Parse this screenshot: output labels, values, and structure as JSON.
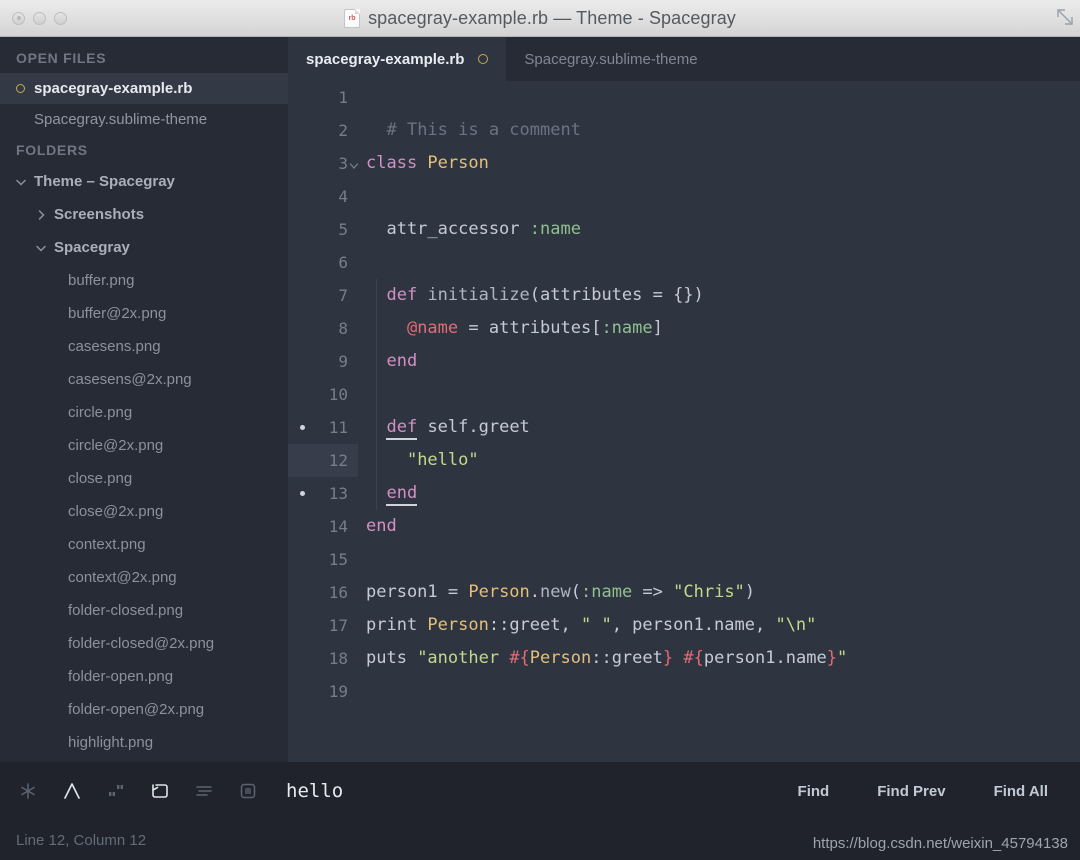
{
  "window": {
    "title": "spacegray-example.rb — Theme - Spacegray",
    "file_icon_label": "rb",
    "traffic_lights": [
      "close",
      "minimize",
      "zoom"
    ]
  },
  "sidebar": {
    "open_files_header": "OPEN FILES",
    "open_files": [
      {
        "label": "spacegray-example.rb",
        "active": true,
        "modified": true
      },
      {
        "label": "Spacegray.sublime-theme",
        "active": false,
        "modified": false
      }
    ],
    "folders_header": "FOLDERS",
    "tree": [
      {
        "label": "Theme – Spacegray",
        "type": "folder",
        "depth": 0,
        "expanded": true
      },
      {
        "label": "Screenshots",
        "type": "folder",
        "depth": 1,
        "expanded": false
      },
      {
        "label": "Spacegray",
        "type": "folder",
        "depth": 1,
        "expanded": true
      },
      {
        "label": "buffer.png",
        "type": "file",
        "depth": 2
      },
      {
        "label": "buffer@2x.png",
        "type": "file",
        "depth": 2
      },
      {
        "label": "casesens.png",
        "type": "file",
        "depth": 2
      },
      {
        "label": "casesens@2x.png",
        "type": "file",
        "depth": 2
      },
      {
        "label": "circle.png",
        "type": "file",
        "depth": 2
      },
      {
        "label": "circle@2x.png",
        "type": "file",
        "depth": 2
      },
      {
        "label": "close.png",
        "type": "file",
        "depth": 2
      },
      {
        "label": "close@2x.png",
        "type": "file",
        "depth": 2
      },
      {
        "label": "context.png",
        "type": "file",
        "depth": 2
      },
      {
        "label": "context@2x.png",
        "type": "file",
        "depth": 2
      },
      {
        "label": "folder-closed.png",
        "type": "file",
        "depth": 2
      },
      {
        "label": "folder-closed@2x.png",
        "type": "file",
        "depth": 2
      },
      {
        "label": "folder-open.png",
        "type": "file",
        "depth": 2
      },
      {
        "label": "folder-open@2x.png",
        "type": "file",
        "depth": 2
      },
      {
        "label": "highlight.png",
        "type": "file",
        "depth": 2
      }
    ]
  },
  "tabs": [
    {
      "label": "spacegray-example.rb",
      "active": true,
      "modified": true
    },
    {
      "label": "Spacegray.sublime-theme",
      "active": false,
      "modified": false
    }
  ],
  "editor": {
    "language": "ruby",
    "active_line": 12,
    "bookmarked_lines": [
      11,
      13
    ],
    "fold_lines": [
      3
    ],
    "lines": [
      {
        "n": 1,
        "tokens": []
      },
      {
        "n": 2,
        "tokens": [
          {
            "t": "  ",
            "c": "pl"
          },
          {
            "t": "# This is a comment",
            "c": "cm"
          }
        ]
      },
      {
        "n": 3,
        "tokens": [
          {
            "t": "class ",
            "c": "k"
          },
          {
            "t": "Person",
            "c": "cn"
          }
        ]
      },
      {
        "n": 4,
        "tokens": []
      },
      {
        "n": 5,
        "tokens": [
          {
            "t": "  attr_accessor ",
            "c": "pl"
          },
          {
            "t": ":name",
            "c": "sy"
          }
        ]
      },
      {
        "n": 6,
        "tokens": []
      },
      {
        "n": 7,
        "tokens": [
          {
            "t": "  ",
            "c": "pl"
          },
          {
            "t": "def ",
            "c": "k"
          },
          {
            "t": "initialize",
            "c": "mt"
          },
          {
            "t": "(attributes = {})",
            "c": "pl"
          }
        ]
      },
      {
        "n": 8,
        "tokens": [
          {
            "t": "    ",
            "c": "pl"
          },
          {
            "t": "@name",
            "c": "iv"
          },
          {
            "t": " = attributes[",
            "c": "pl"
          },
          {
            "t": ":name",
            "c": "sy"
          },
          {
            "t": "]",
            "c": "pl"
          }
        ]
      },
      {
        "n": 9,
        "tokens": [
          {
            "t": "  ",
            "c": "pl"
          },
          {
            "t": "end",
            "c": "k"
          }
        ]
      },
      {
        "n": 10,
        "tokens": []
      },
      {
        "n": 11,
        "tokens": [
          {
            "t": "  ",
            "c": "pl"
          },
          {
            "t": "def",
            "c": "k",
            "u": true
          },
          {
            "t": " self.greet",
            "c": "pl"
          }
        ]
      },
      {
        "n": 12,
        "tokens": [
          {
            "t": "    ",
            "c": "pl"
          },
          {
            "t": "\"hello\"",
            "c": "st"
          }
        ]
      },
      {
        "n": 13,
        "tokens": [
          {
            "t": "  ",
            "c": "pl"
          },
          {
            "t": "end",
            "c": "k",
            "u": true
          }
        ]
      },
      {
        "n": 14,
        "tokens": [
          {
            "t": "end",
            "c": "k"
          }
        ]
      },
      {
        "n": 15,
        "tokens": []
      },
      {
        "n": 16,
        "tokens": [
          {
            "t": "person1 = ",
            "c": "pl"
          },
          {
            "t": "Person",
            "c": "cn"
          },
          {
            "t": ".",
            "c": "pl"
          },
          {
            "t": "new",
            "c": "mt"
          },
          {
            "t": "(",
            "c": "pl"
          },
          {
            "t": ":name",
            "c": "sy"
          },
          {
            "t": " => ",
            "c": "pl"
          },
          {
            "t": "\"Chris\"",
            "c": "st"
          },
          {
            "t": ")",
            "c": "pl"
          }
        ]
      },
      {
        "n": 17,
        "tokens": [
          {
            "t": "print ",
            "c": "pl"
          },
          {
            "t": "Person",
            "c": "cn"
          },
          {
            "t": "::greet, ",
            "c": "pl"
          },
          {
            "t": "\" \"",
            "c": "st"
          },
          {
            "t": ", person1.name, ",
            "c": "pl"
          },
          {
            "t": "\"\\n\"",
            "c": "st"
          }
        ]
      },
      {
        "n": 18,
        "tokens": [
          {
            "t": "puts ",
            "c": "pl"
          },
          {
            "t": "\"another ",
            "c": "st"
          },
          {
            "t": "#{",
            "c": "ip"
          },
          {
            "t": "Person",
            "c": "cn"
          },
          {
            "t": "::greet",
            "c": "pl"
          },
          {
            "t": "}",
            "c": "ip"
          },
          {
            "t": " ",
            "c": "st"
          },
          {
            "t": "#{",
            "c": "ip"
          },
          {
            "t": "person1.name",
            "c": "pl"
          },
          {
            "t": "}",
            "c": "ip"
          },
          {
            "t": "\"",
            "c": "st"
          }
        ]
      },
      {
        "n": 19,
        "tokens": []
      }
    ]
  },
  "findbar": {
    "icons": [
      {
        "name": "regex-icon",
        "glyph": "✳",
        "active": false
      },
      {
        "name": "case-sensitive-icon",
        "glyph": "A",
        "active": true
      },
      {
        "name": "whole-word-icon",
        "glyph": "„“",
        "active": false
      },
      {
        "name": "wrap-icon",
        "glyph": "↩",
        "active": true
      },
      {
        "name": "in-selection-icon",
        "glyph": "≡",
        "active": false
      },
      {
        "name": "highlight-results-icon",
        "glyph": "▣",
        "active": false
      }
    ],
    "search_value": "hello",
    "search_placeholder": "Find",
    "buttons": [
      {
        "label": "Find"
      },
      {
        "label": "Find Prev"
      },
      {
        "label": "Find All"
      }
    ]
  },
  "statusbar": {
    "position": "Line 12, Column 12",
    "watermark": "https://blog.csdn.net/weixin_45794138"
  },
  "colors": {
    "titlebar": "#e4e4e4",
    "sidebar_bg": "#272b35",
    "editor_bg": "#2f3441",
    "chrome_bg": "#20232c",
    "accent_modified": "#c6a855",
    "keyword": "#d291c4",
    "constant": "#e3c07b",
    "symbol": "#8fc08f",
    "string": "#c3d98a",
    "comment": "#6b7382",
    "instance_var": "#e06c75"
  }
}
